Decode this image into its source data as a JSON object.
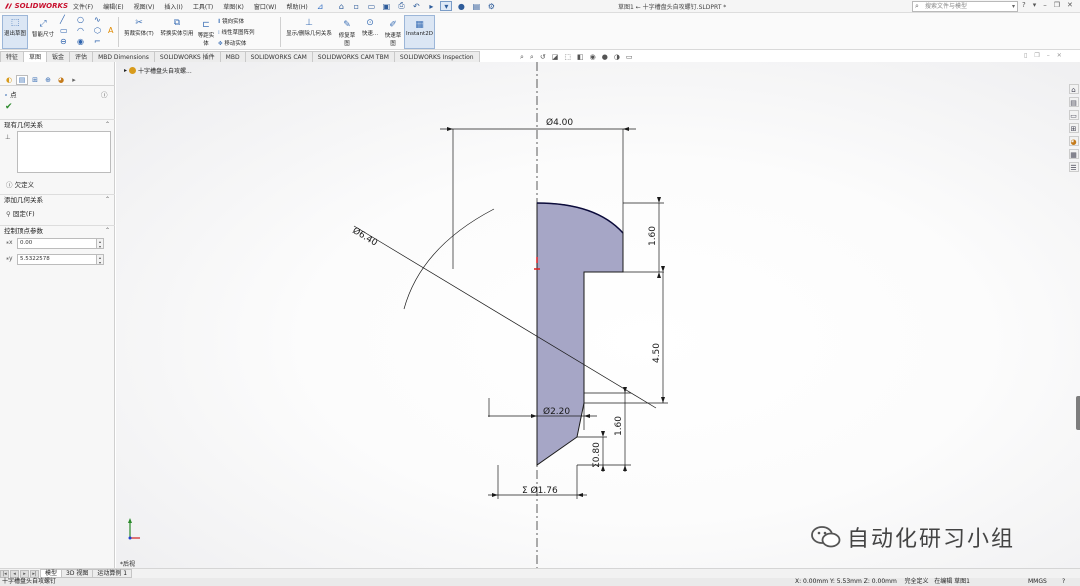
{
  "app": {
    "name": "SOLIDWORKS",
    "doc_title": "草图1 ← 十字槽盘头自攻螺钉.SLDPRT *",
    "search_placeholder": "搜索文件与模型"
  },
  "menu": [
    "文件(F)",
    "编辑(E)",
    "视图(V)",
    "插入(I)",
    "工具(T)",
    "草图(K)",
    "窗口(W)",
    "帮助(H)"
  ],
  "command_manager": {
    "exit_sketch": "退出草图",
    "smart_dimension": "智能尺寸",
    "trim_entities": "剪裁实体(T)",
    "convert_entities": "转换实体引用",
    "offset_line1": "等距实",
    "offset_line2": "体",
    "mirror": "镜向实体",
    "linear_pattern": "线性草图阵列",
    "move_entities": "移动实体",
    "display_relations": "显示/删除几何关系",
    "repair_line1": "修复草",
    "repair_line2": "图",
    "quick_snaps": "快速...",
    "rapid_sketch_line1": "快速草",
    "rapid_sketch_line2": "图",
    "instant2d": "Instant2D"
  },
  "tabs": [
    "特征",
    "草图",
    "钣金",
    "评估",
    "MBD Dimensions",
    "SOLIDWORKS 插件",
    "MBD",
    "SOLIDWORKS CAM",
    "SOLIDWORKS CAM TBM",
    "SOLIDWORKS Inspection"
  ],
  "active_tab": "草图",
  "property_manager": {
    "title": "点",
    "existing_relations": "现有几何关系",
    "under_defined": "欠定义",
    "add_relations": "添加几何关系",
    "fix": "固定(F)",
    "parameters": "控制顶点参数",
    "x_value": "0.00",
    "y_value": "5.5322578"
  },
  "graphics": {
    "tree_label": "十字槽盘头自攻螺...",
    "view_label": "*后视",
    "watermark": "自动化研习小组"
  },
  "dimensions": {
    "d_4_00": "Ø4.00",
    "d_6_40": "Ø6.40",
    "v_1_60_top": "1.60",
    "v_4_50": "4.50",
    "d_2_20": "Ø2.20",
    "v_1_60_bottom": "1.60",
    "v_0_80": "Σ0.80",
    "d_1_76": "Σ Ø1.76"
  },
  "bottom_tabs": [
    "模型",
    "3D 视图",
    "运动算例 1"
  ],
  "active_bottom_tab": "模型",
  "status": {
    "doc": "十字槽盘头自攻螺钉",
    "coords": "X: 0.00mm Y: 5.53mm Z: 0.00mm",
    "state": "完全定义",
    "editing": "在编辑 草图1",
    "units": "MMGS"
  },
  "colors": {
    "brand": "#c8102e",
    "profile_fill": "#a6a6c6",
    "dimension": "#1a1a1a",
    "accent": "#3470c4"
  }
}
